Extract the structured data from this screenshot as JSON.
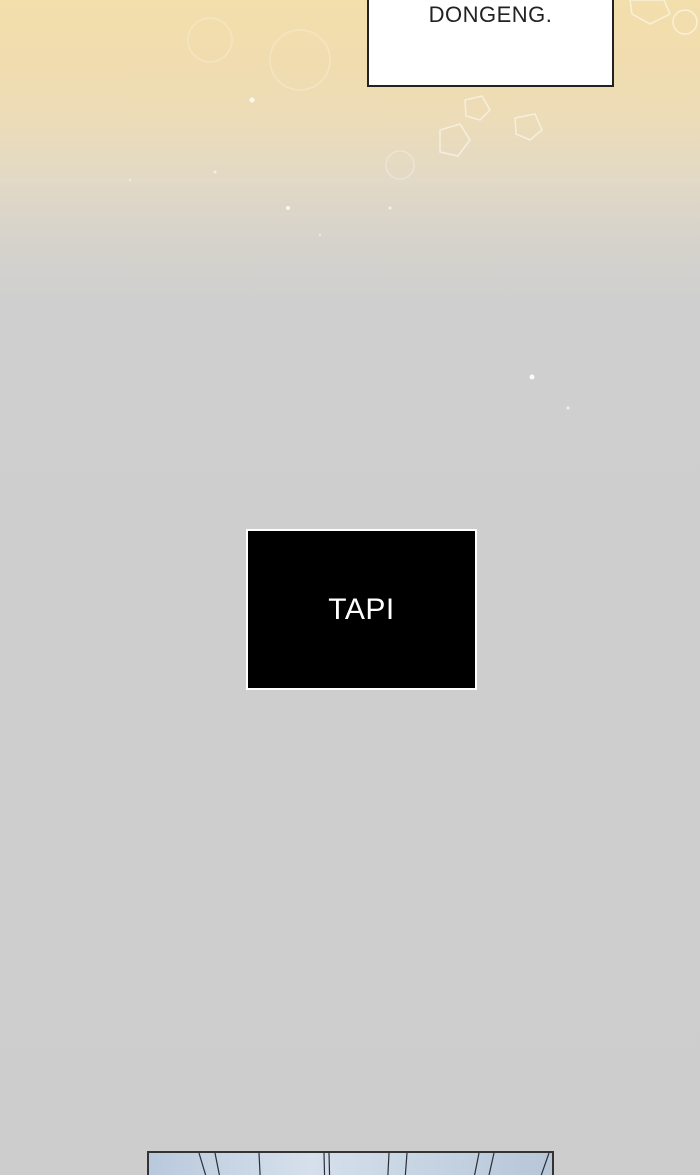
{
  "panels": {
    "top_caption": {
      "text": "DONGENG."
    },
    "narration": {
      "text": "TAPI"
    }
  },
  "colors": {
    "warm_glow": "#f3dfac",
    "background_gray": "#cdcdcd",
    "caption_bg": "#ffffff",
    "narration_bg": "#000000",
    "next_panel_sky": "#c5d3e2"
  }
}
